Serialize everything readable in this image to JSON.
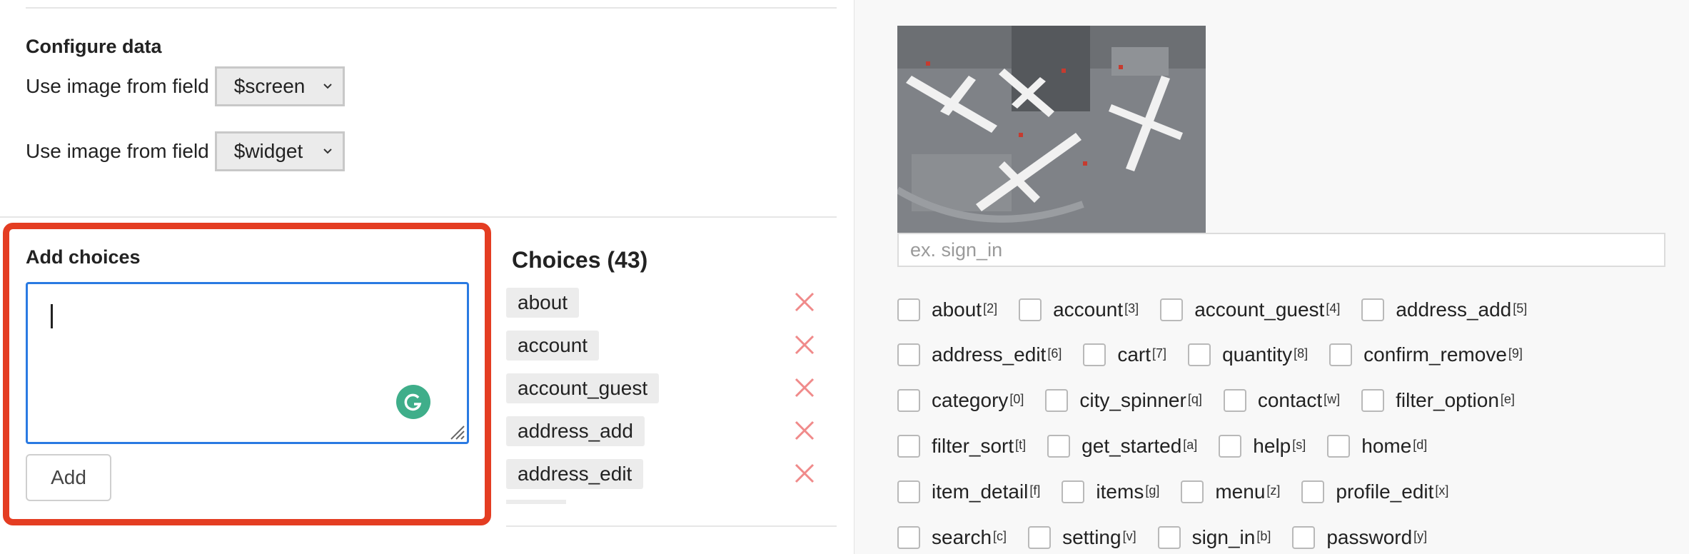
{
  "configure": {
    "title": "Configure data",
    "rows": [
      {
        "label": "Use image from field",
        "value": "$screen"
      },
      {
        "label": "Use image from field",
        "value": "$widget"
      }
    ]
  },
  "add_choices": {
    "title": "Add choices",
    "textarea_value": "",
    "button_label": "Add"
  },
  "choices": {
    "title": "Choices (43)",
    "items": [
      "about",
      "account",
      "account_guest",
      "address_add",
      "address_edit"
    ]
  },
  "preview": {
    "search_placeholder": "ex. sign_in",
    "rows": [
      [
        {
          "label": "about",
          "key": "[2]"
        },
        {
          "label": "account",
          "key": "[3]"
        },
        {
          "label": "account_guest",
          "key": "[4]"
        },
        {
          "label": "address_add",
          "key": "[5]"
        }
      ],
      [
        {
          "label": "address_edit",
          "key": "[6]"
        },
        {
          "label": "cart",
          "key": "[7]"
        },
        {
          "label": "quantity",
          "key": "[8]"
        },
        {
          "label": "confirm_remove",
          "key": "[9]"
        }
      ],
      [
        {
          "label": "category",
          "key": "[0]"
        },
        {
          "label": "city_spinner",
          "key": "[q]"
        },
        {
          "label": "contact",
          "key": "[w]"
        },
        {
          "label": "filter_option",
          "key": "[e]"
        }
      ],
      [
        {
          "label": "filter_sort",
          "key": "[t]"
        },
        {
          "label": "get_started",
          "key": "[a]"
        },
        {
          "label": "help",
          "key": "[s]"
        },
        {
          "label": "home",
          "key": "[d]"
        }
      ],
      [
        {
          "label": "item_detail",
          "key": "[f]"
        },
        {
          "label": "items",
          "key": "[g]"
        },
        {
          "label": "menu",
          "key": "[z]"
        },
        {
          "label": "profile_edit",
          "key": "[x]"
        }
      ],
      [
        {
          "label": "search",
          "key": "[c]"
        },
        {
          "label": "setting",
          "key": "[v]"
        },
        {
          "label": "sign_in",
          "key": "[b]"
        },
        {
          "label": "password",
          "key": "[y]"
        }
      ]
    ]
  },
  "colors": {
    "highlight": "#e43d22",
    "focus_border": "#2a7ae2",
    "remove_x": "#f08a8a",
    "grammarly": "#3fae8a"
  }
}
